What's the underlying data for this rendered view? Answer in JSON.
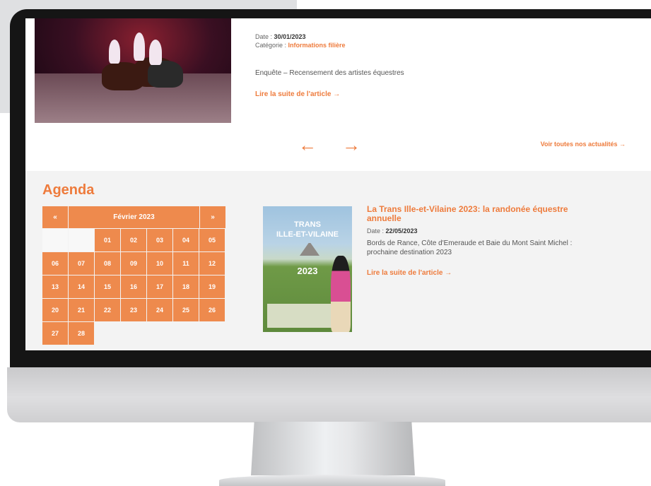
{
  "article": {
    "date_label": "Date : ",
    "date_value": "30/01/2023",
    "category_label": "Catégorie : ",
    "category_value": "Informations filière",
    "description": "Enquête – Recensement des artistes équestres",
    "read_more": "Lire la suite de l'article →"
  },
  "pagination": {
    "prev_glyph": "←",
    "next_glyph": "→",
    "see_all": "Voir toutes nos actualités →"
  },
  "agenda": {
    "title": "Agenda",
    "calendar": {
      "prev": "«",
      "month": "Février 2023",
      "next": "»",
      "leading_empty": 2,
      "days": [
        "01",
        "02",
        "03",
        "04",
        "05",
        "06",
        "07",
        "08",
        "09",
        "10",
        "11",
        "12",
        "13",
        "14",
        "15",
        "16",
        "17",
        "18",
        "19",
        "20",
        "21",
        "22",
        "23",
        "24",
        "25",
        "26",
        "27",
        "28"
      ]
    },
    "event": {
      "title": "La Trans Ille-et-Vilaine 2023: la randonée équestre annuelle",
      "date_label": "Date : ",
      "date_value": "22/05/2023",
      "description": "Bords de Rance, Côte d'Emeraude et Baie du Mont Saint Michel : prochaine destination 2023",
      "read_more": "Lire la suite de l'article →",
      "poster": {
        "line1": "TRANS",
        "line2": "ILLE-ET-VILAINE",
        "year": "2023"
      }
    }
  },
  "colors": {
    "accent": "#ee7b3c",
    "calendar": "#ee8a4d",
    "section_bg": "#f3f3f3"
  }
}
